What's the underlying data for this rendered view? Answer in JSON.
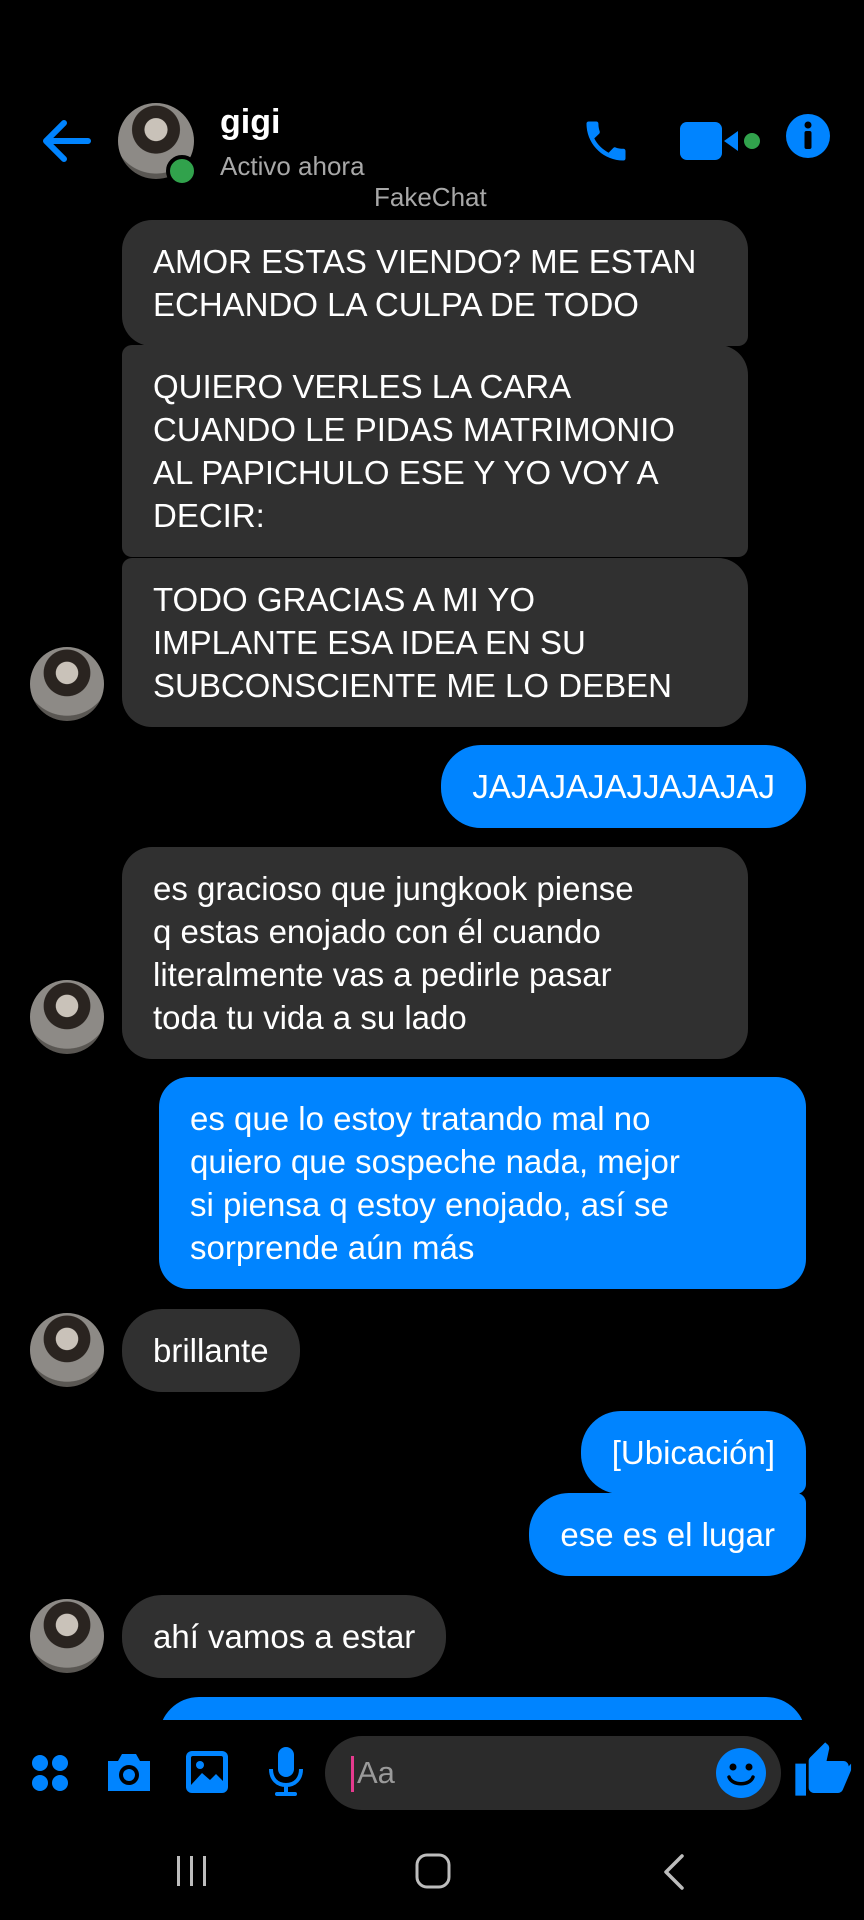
{
  "header": {
    "contact_name": "gigi",
    "status": "Activo ahora",
    "watermark": "FakeChat",
    "icons": [
      "back-arrow-icon",
      "phone-icon",
      "video-camera-icon",
      "info-icon"
    ]
  },
  "messages": [
    {
      "side": "in",
      "text": "AMOR ESTAS VIENDO? ME ESTAN\nECHANDO LA CULPA DE TODO"
    },
    {
      "side": "in",
      "text": "QUIERO VERLES LA CARA\nCUANDO LE PIDAS MATRIMONIO\nAL PAPICHULO ESE Y YO VOY A\nDECIR:"
    },
    {
      "side": "in",
      "text": "TODO GRACIAS A MI YO\nIMPLANTE ESA IDEA EN SU\nSUBCONSCIENTE ME LO DEBEN"
    },
    {
      "side": "out",
      "text": "JAJAJAJAJJAJAJAJ"
    },
    {
      "side": "in",
      "text": "es gracioso que jungkook piense\nq estas enojado con él cuando\nliteralmente vas a pedirle pasar\ntoda tu vida a su lado"
    },
    {
      "side": "out",
      "text": "es que lo estoy tratando mal no\nquiero que sospeche nada, mejor\nsi piensa q estoy enojado, así se\nsorprende aún más"
    },
    {
      "side": "in",
      "text": "brillante"
    },
    {
      "side": "out",
      "text": "[Ubicación]"
    },
    {
      "side": "out",
      "text": "ese es el lugar"
    },
    {
      "side": "in",
      "text": "ahí vamos a estar"
    }
  ],
  "composer": {
    "placeholder": "Aa",
    "icons": [
      "apps-icon",
      "camera-icon",
      "image-icon",
      "microphone-icon",
      "emoji-icon",
      "like-icon"
    ]
  },
  "nav": {
    "icons": [
      "recent-apps-icon",
      "home-icon",
      "back-icon"
    ]
  },
  "colors": {
    "accent": "#0084ff",
    "incoming_bubble": "#303030",
    "background": "#000000",
    "online": "#31a24c"
  }
}
